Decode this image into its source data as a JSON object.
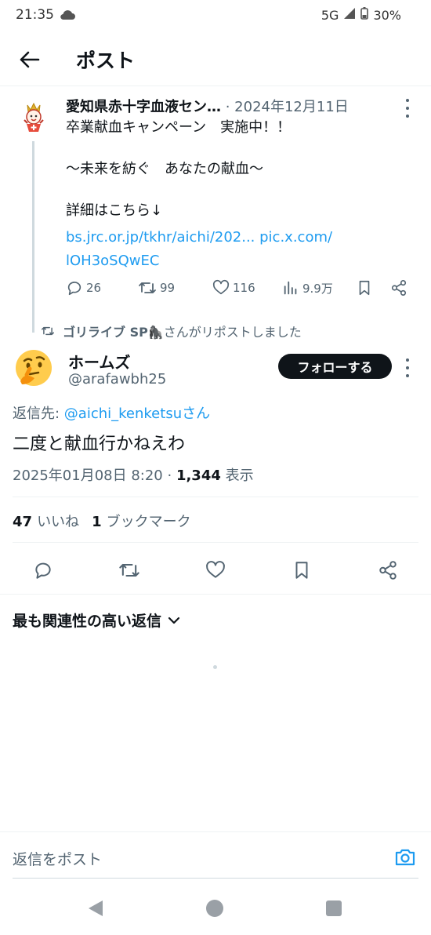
{
  "status_bar": {
    "time": "21:35",
    "network": "5G",
    "battery": "30%"
  },
  "header": {
    "title": "ポスト"
  },
  "parent_post": {
    "author": "愛知県赤十字血液セン…",
    "date": " · 2024年12月11日",
    "lines": [
      "卒業献血キャンペーン　実施中！！",
      "",
      "〜未来を紡ぐ　あなたの献血〜",
      "",
      "詳細はこちら↓"
    ],
    "link_line1": "bs.jrc.or.jp/tkhr/aichi/202... pic.x.com/",
    "link_line2": "lOH3oSQwEC",
    "replies": "26",
    "reposts": "99",
    "likes": "116",
    "views": "9.9万"
  },
  "repost_notice": {
    "user": "ゴリライブ SP🦍",
    "text": "さんがリポストしました"
  },
  "main_post": {
    "author": "ホームズ",
    "handle": "@arafawbh25",
    "follow_label": "フォローする",
    "reply_prefix": "返信先: ",
    "reply_mention": "@aichi_kenketsuさん",
    "text": "二度と献血行かねえわ",
    "timestamp": "2025年01月08日 8:20 · ",
    "views_count": "1,344",
    "views_label": " 表示",
    "likes_count": "47",
    "likes_label": "いいね",
    "bookmarks_count": "1",
    "bookmarks_label": "ブックマーク"
  },
  "sort": {
    "label": "最も関連性の高い返信"
  },
  "composer": {
    "placeholder": "返信をポスト"
  },
  "colors": {
    "accent": "#1d9bf0",
    "text": "#0f1419",
    "muted": "#536471",
    "border": "#eff3f4"
  }
}
